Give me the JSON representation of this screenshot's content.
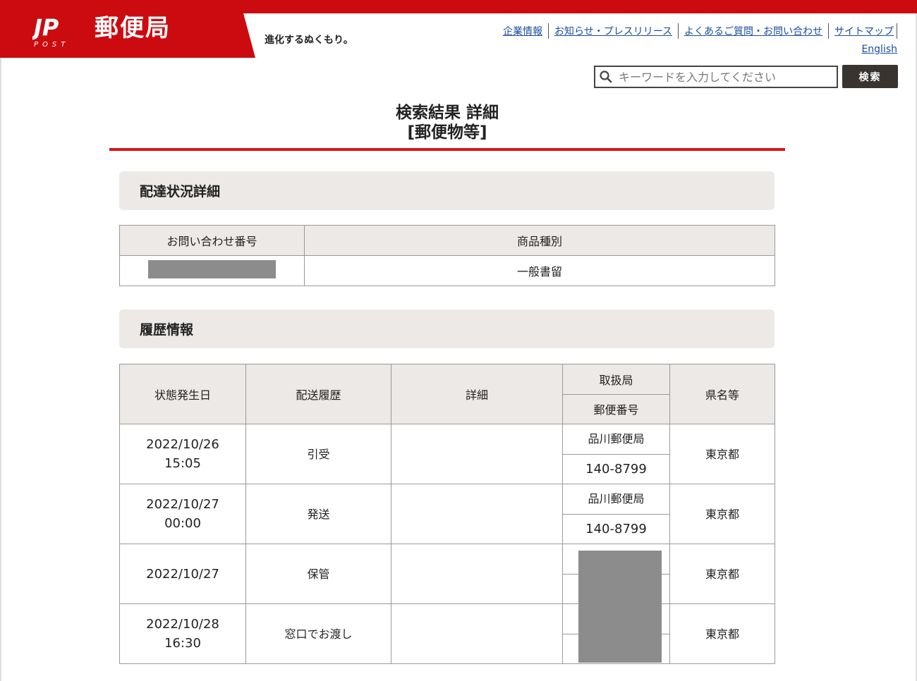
{
  "header": {
    "logo_text": "郵便局",
    "logo_mark": "JP POST",
    "tagline": "進化するぬくもり。",
    "nav_links": [
      "企業情報",
      "お知らせ・プレスリリース",
      "よくあるご質問・お問い合わせ",
      "サイトマップ"
    ],
    "english_link": "English",
    "search": {
      "placeholder": "キーワードを入力してください",
      "button_label": "検索"
    },
    "brand_color": "#cc0b11"
  },
  "page": {
    "title_line1": "検索結果 詳細",
    "title_line2": "[郵便物等]"
  },
  "delivery_status": {
    "heading": "配達状況詳細",
    "headers": [
      "お問い合わせ番号",
      "商品種別"
    ],
    "tracking_number_redacted": true,
    "product_type": "一般書留"
  },
  "history": {
    "heading": "履歴情報",
    "headers": {
      "date": "状態発生日",
      "event": "配送履歴",
      "detail": "詳細",
      "office": "取扱局",
      "postal_code": "郵便番号",
      "prefecture": "県名等"
    },
    "rows": [
      {
        "date": "2022/10/26",
        "time": "15:05",
        "event": "引受",
        "detail": "",
        "office": "品川郵便局",
        "postal_code": "140-8799",
        "prefecture": "東京都"
      },
      {
        "date": "2022/10/27",
        "time": "00:00",
        "event": "発送",
        "detail": "",
        "office": "品川郵便局",
        "postal_code": "140-8799",
        "prefecture": "東京都"
      },
      {
        "date": "2022/10/27",
        "time": "",
        "event": "保管",
        "detail": "",
        "office": "",
        "postal_code": "",
        "prefecture": "東京都"
      },
      {
        "date": "2022/10/28",
        "time": "16:30",
        "event": "窓口でお渡し",
        "detail": "",
        "office": "",
        "postal_code": "",
        "prefecture": "東京都"
      }
    ]
  }
}
